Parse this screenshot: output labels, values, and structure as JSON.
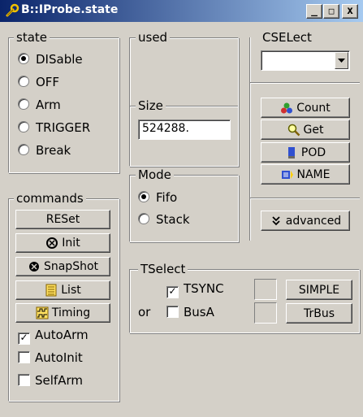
{
  "window": {
    "title": "B::IProbe.state",
    "minimize": "_",
    "maximize": "□",
    "close": "x"
  },
  "state": {
    "legend": "state",
    "options": [
      {
        "label": "DISable",
        "selected": true
      },
      {
        "label": "OFF",
        "selected": false
      },
      {
        "label": "Arm",
        "selected": false
      },
      {
        "label": "TRIGGER",
        "selected": false
      },
      {
        "label": "Break",
        "selected": false
      }
    ]
  },
  "commands": {
    "legend": "commands",
    "buttons": [
      {
        "label": "RESet",
        "icon": ""
      },
      {
        "label": "Init",
        "icon": "stop-circle-icon"
      },
      {
        "label": "SnapShot",
        "icon": "snapshot-circle-icon"
      },
      {
        "label": "List",
        "icon": "list-icon"
      },
      {
        "label": "Timing",
        "icon": "timing-icon"
      }
    ],
    "checks": [
      {
        "label": "AutoArm",
        "checked": true
      },
      {
        "label": "AutoInit",
        "checked": false
      },
      {
        "label": "SelfArm",
        "checked": false
      }
    ]
  },
  "used": {
    "legend": "used"
  },
  "size": {
    "legend": "Size",
    "value": "524288."
  },
  "mode": {
    "legend": "Mode",
    "options": [
      {
        "label": "Fifo",
        "selected": true
      },
      {
        "label": "Stack",
        "selected": false
      }
    ]
  },
  "cselect": {
    "legend": "CSELect",
    "value": ""
  },
  "actions": {
    "count": {
      "label": "Count",
      "icon": "count-icon"
    },
    "get": {
      "label": "Get",
      "icon": "magnifier-icon"
    },
    "pod": {
      "label": "POD",
      "icon": "pod-icon"
    },
    "name": {
      "label": "NAME",
      "icon": "name-icon"
    },
    "advanced": {
      "label": "advanced",
      "icon": "double-chevron-down-icon"
    }
  },
  "tselect": {
    "legend": "TSelect",
    "tsync": {
      "label": "TSYNC",
      "checked": true
    },
    "or_label": "or",
    "busa": {
      "label": "BusA",
      "checked": false
    },
    "simple": "SIMPLE",
    "trbus": "TrBus"
  },
  "colors": {
    "face": "#d4d0c8",
    "title_start": "#0a246a",
    "title_end": "#a6caf0"
  }
}
